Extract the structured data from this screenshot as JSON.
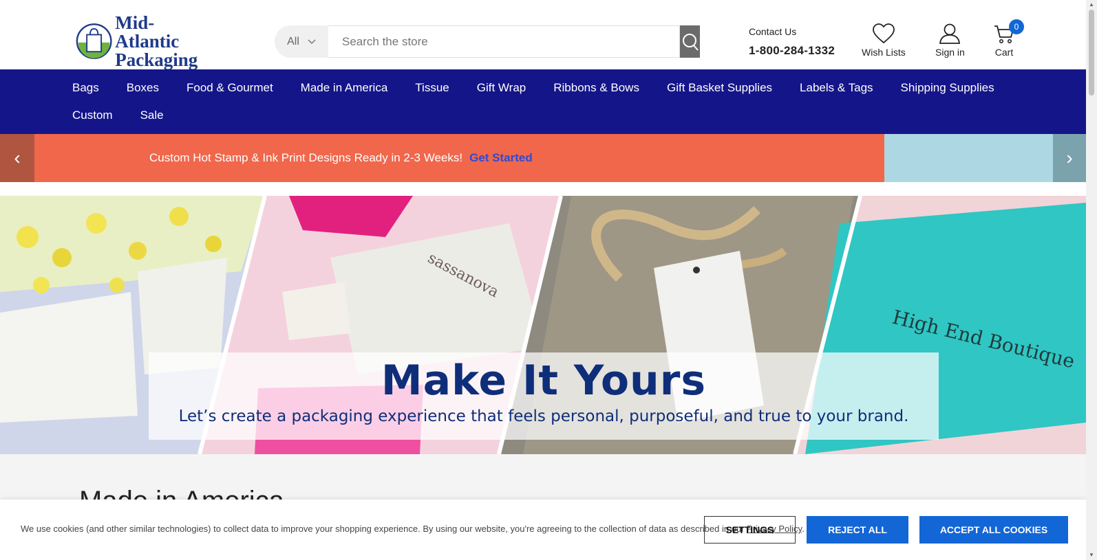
{
  "header": {
    "logo_line1": "Mid-Atlantic",
    "logo_line2": "Packaging",
    "search_category": "All",
    "search_placeholder": "Search the store",
    "contact_label": "Contact Us",
    "contact_phone": "1-800-284-1332",
    "wishlist_label": "Wish Lists",
    "signin_label": "Sign in",
    "cart_label": "Cart",
    "cart_count": "0"
  },
  "nav": {
    "row1": [
      "Bags",
      "Boxes",
      "Food & Gourmet",
      "Made in America",
      "Tissue",
      "Gift Wrap",
      "Ribbons & Bows",
      "Gift Basket Supplies",
      "Labels & Tags",
      "Shipping Supplies"
    ],
    "row2": [
      "Custom",
      "Sale"
    ]
  },
  "promo": {
    "text": "Custom Hot Stamp & Ink Print Designs Ready in 2-3 Weeks!",
    "link": "Get Started",
    "prev": "‹",
    "next": "›"
  },
  "hero": {
    "title": "Make It Yours",
    "subtitle": "Let’s create a packaging experience that feels personal, purposeful, and true to your brand.",
    "box_text_1": "sassanova",
    "box_text_2": "High End Boutique"
  },
  "section": {
    "title": "Made in America"
  },
  "cookie": {
    "text_before": "We use cookies (and other similar technologies) to collect data to improve your shopping experience. By using our website, you're agreeing to the collection of data as described in our ",
    "policy_link": "Privacy Policy",
    "text_after": ".",
    "settings": "SETTINGS",
    "reject": "REJECT ALL",
    "accept": "ACCEPT ALL COOKIES"
  },
  "colors": {
    "nav_bg": "#15158a",
    "promo_bg": "#f0674c",
    "accent_blue": "#1366d6",
    "hero_title": "#0f2e7a"
  }
}
